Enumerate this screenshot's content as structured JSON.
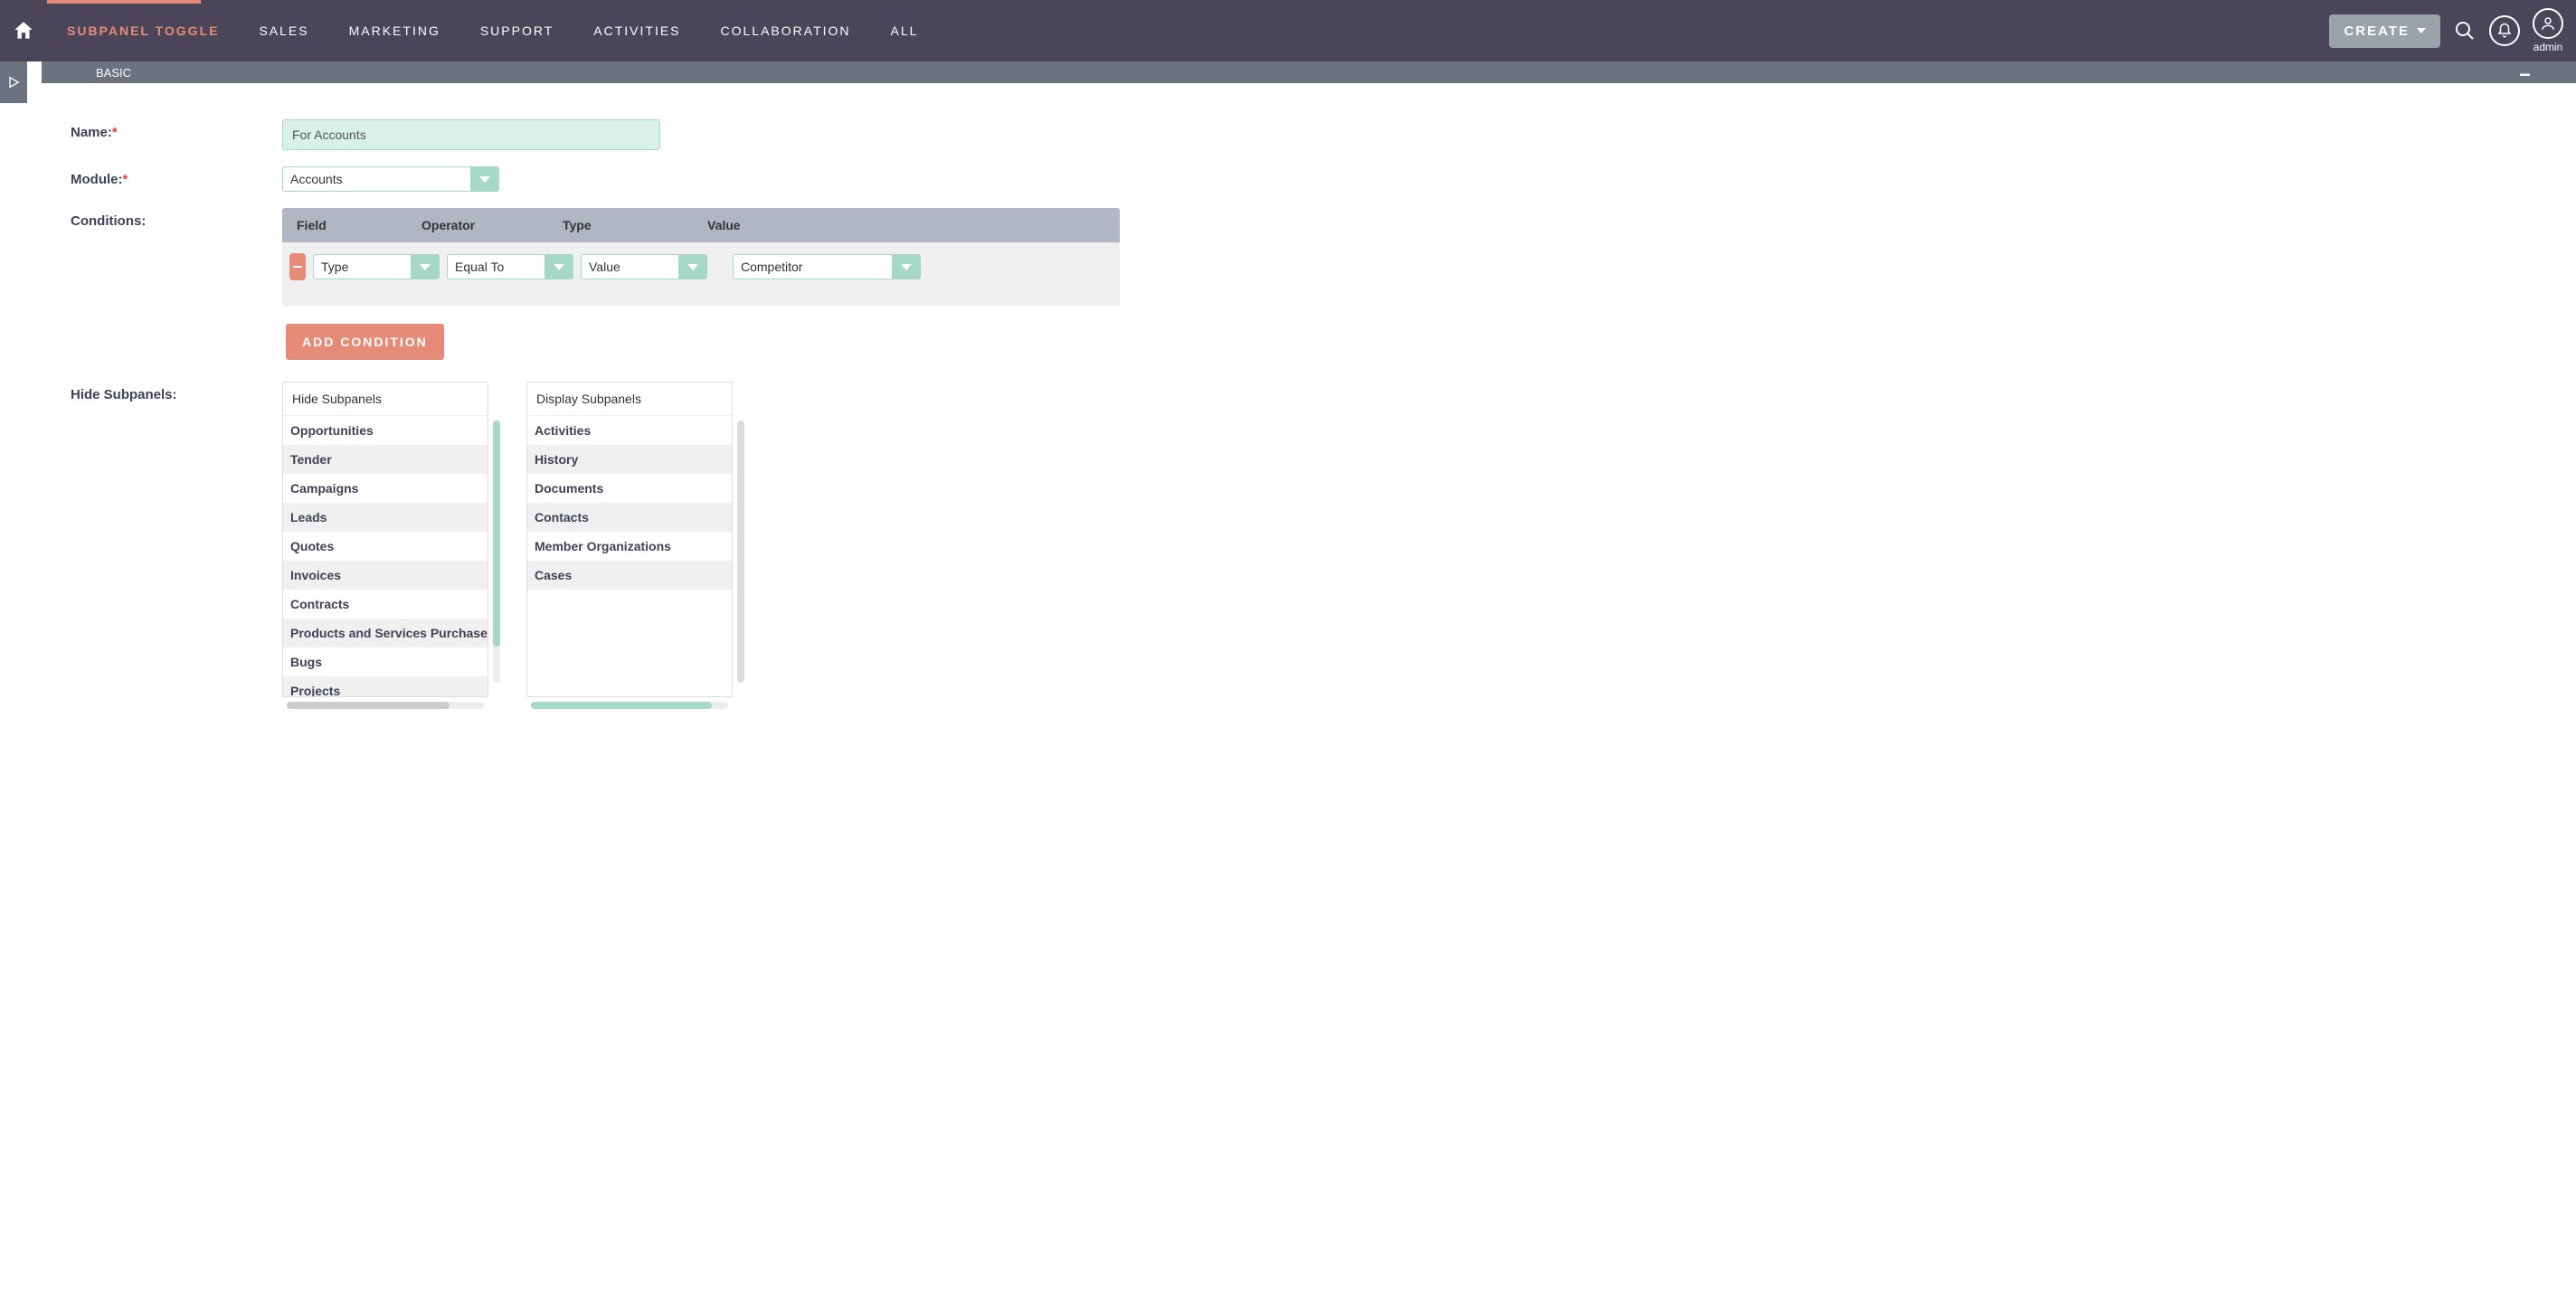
{
  "nav": {
    "brand": "SUBPANEL TOGGLE",
    "items": [
      "SALES",
      "MARKETING",
      "SUPPORT",
      "ACTIVITIES",
      "COLLABORATION",
      "ALL"
    ],
    "create": "CREATE",
    "user": "admin"
  },
  "subbar": {
    "title": "BASIC"
  },
  "form": {
    "name_label": "Name:",
    "name_value": "For Accounts",
    "module_label": "Module:",
    "module_value": "Accounts",
    "conditions_label": "Conditions:",
    "cond_headers": {
      "field": "Field",
      "operator": "Operator",
      "type": "Type",
      "value": "Value"
    },
    "cond_row": {
      "field": "Type",
      "operator": "Equal To",
      "type": "Value",
      "value": "Competitor"
    },
    "add_condition": "ADD CONDITION",
    "hide_subpanels_label": "Hide Subpanels:",
    "hide_header": "Hide Subpanels",
    "display_header": "Display Subpanels",
    "hide_items": [
      "Opportunities",
      "Tender",
      "Campaigns",
      "Leads",
      "Quotes",
      "Invoices",
      "Contracts",
      "Products and Services Purchased",
      "Bugs",
      "Projects"
    ],
    "display_items": [
      "Activities",
      "History",
      "Documents",
      "Contacts",
      "Member Organizations",
      "Cases"
    ]
  }
}
